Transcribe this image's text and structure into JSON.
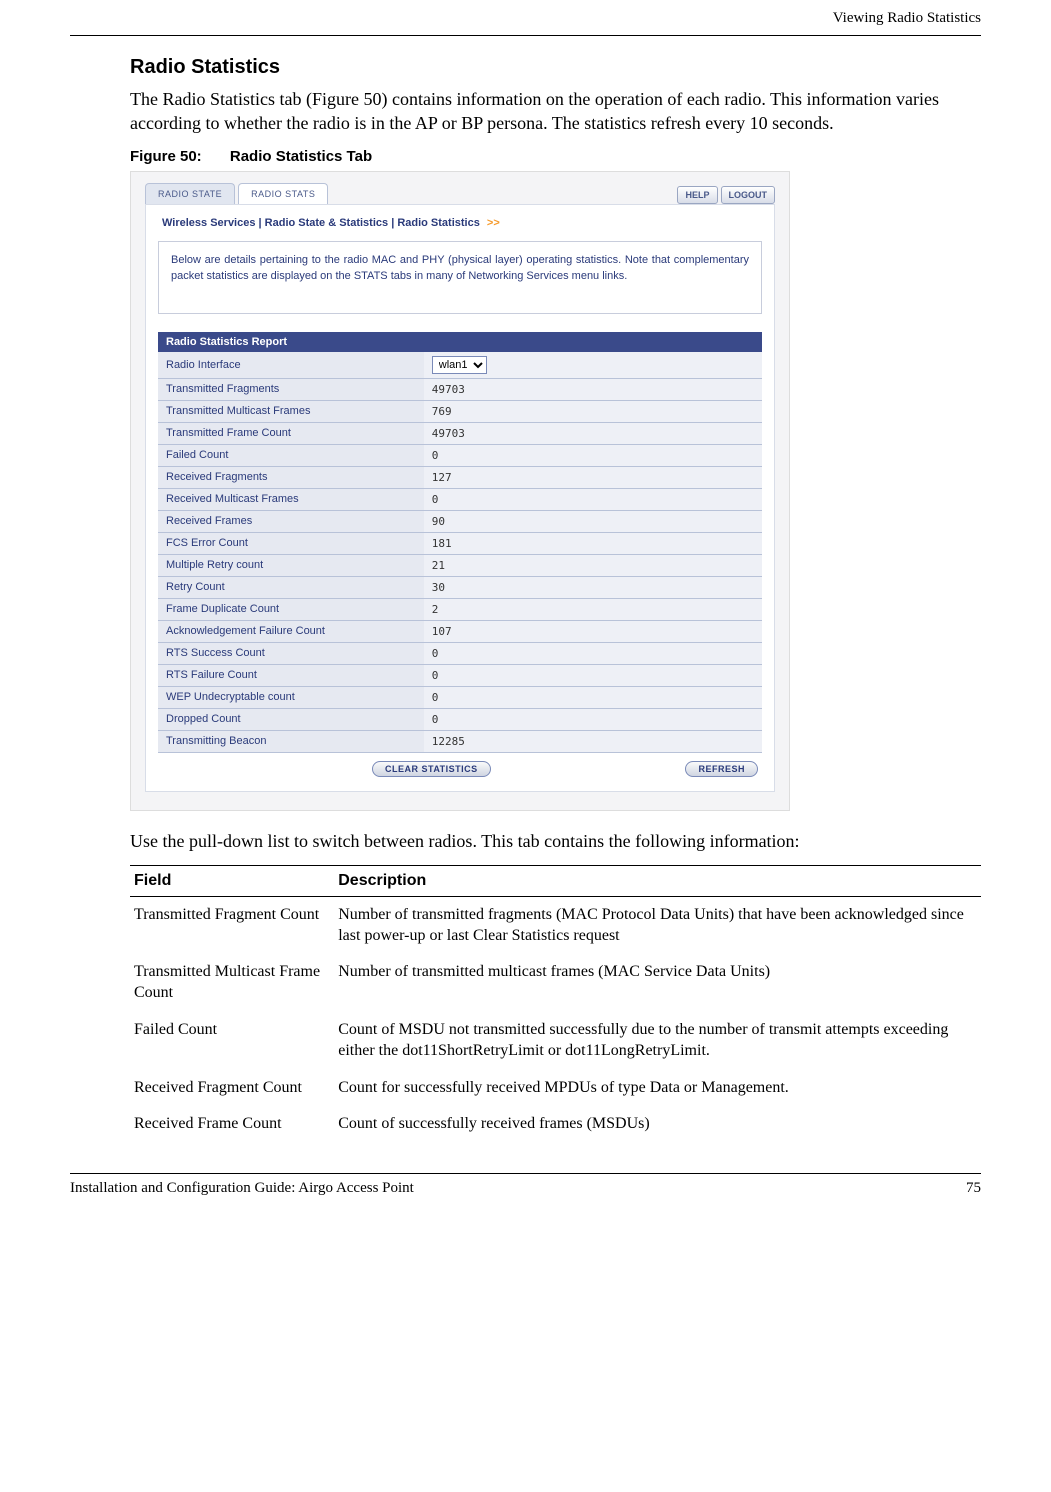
{
  "header": {
    "running_head": "Viewing Radio Statistics"
  },
  "section": {
    "title": "Radio Statistics",
    "intro": "The Radio Statistics tab (Figure 50) contains information on the operation of each radio. This information varies according to whether the radio is in the AP or BP persona. The statistics refresh every 10 seconds."
  },
  "figure": {
    "label": "Figure 50:",
    "title": "Radio Statistics Tab"
  },
  "screenshot": {
    "tabs": {
      "state": "RADIO STATE",
      "stats": "RADIO STATS"
    },
    "top_buttons": {
      "help": "HELP",
      "logout": "LOGOUT"
    },
    "breadcrumb": "Wireless Services | Radio State & Statistics | Radio Statistics",
    "breadcrumb_arrows": ">>",
    "intro_text": "Below are details pertaining to the radio MAC and PHY (physical layer) operating statistics. Note that complementary packet statistics are displayed on the STATS tabs in many of Networking Services menu links.",
    "report_title": "Radio Statistics Report",
    "interface_label": "Radio Interface",
    "interface_value": "wlan1",
    "rows": [
      {
        "label": "Transmitted Fragments",
        "value": "49703"
      },
      {
        "label": "Transmitted Multicast Frames",
        "value": "769"
      },
      {
        "label": "Transmitted Frame Count",
        "value": "49703"
      },
      {
        "label": "Failed Count",
        "value": "0"
      },
      {
        "label": "Received Fragments",
        "value": "127"
      },
      {
        "label": "Received Multicast Frames",
        "value": "0"
      },
      {
        "label": "Received Frames",
        "value": "90"
      },
      {
        "label": "FCS Error Count",
        "value": "181"
      },
      {
        "label": "Multiple Retry count",
        "value": "21"
      },
      {
        "label": "Retry Count",
        "value": "30"
      },
      {
        "label": "Frame Duplicate Count",
        "value": "2"
      },
      {
        "label": "Acknowledgement Failure Count",
        "value": "107"
      },
      {
        "label": "RTS Success Count",
        "value": "0"
      },
      {
        "label": "RTS Failure Count",
        "value": "0"
      },
      {
        "label": "WEP Undecryptable count",
        "value": "0"
      },
      {
        "label": "Dropped Count",
        "value": "0"
      },
      {
        "label": "Transmitting Beacon",
        "value": "12285"
      }
    ],
    "buttons": {
      "clear": "CLEAR STATISTICS",
      "refresh": "REFRESH"
    }
  },
  "after_figure": "Use the pull-down list to switch between radios. This tab contains the following information:",
  "desc_table": {
    "head_field": "Field",
    "head_desc": "Description",
    "rows": [
      {
        "field": "Transmitted Fragment Count",
        "desc": "Number of transmitted fragments (MAC Protocol Data Units) that have been acknowledged since last power-up or last Clear Statistics request"
      },
      {
        "field": "Transmitted Multicast Frame Count",
        "desc": "Number of transmitted multicast frames (MAC Service Data Units)"
      },
      {
        "field": "Failed Count",
        "desc": "Count of MSDU not transmitted successfully due to the number of transmit attempts exceeding either the dot11ShortRetryLimit or dot11LongRetryLimit."
      },
      {
        "field": "Received Fragment Count",
        "desc": "Count for successfully received MPDUs of type Data or Management."
      },
      {
        "field": "Received Frame Count",
        "desc": "Count of successfully received frames (MSDUs)"
      }
    ]
  },
  "footer": {
    "left": "Installation and Configuration Guide: Airgo Access Point",
    "right": "75"
  }
}
